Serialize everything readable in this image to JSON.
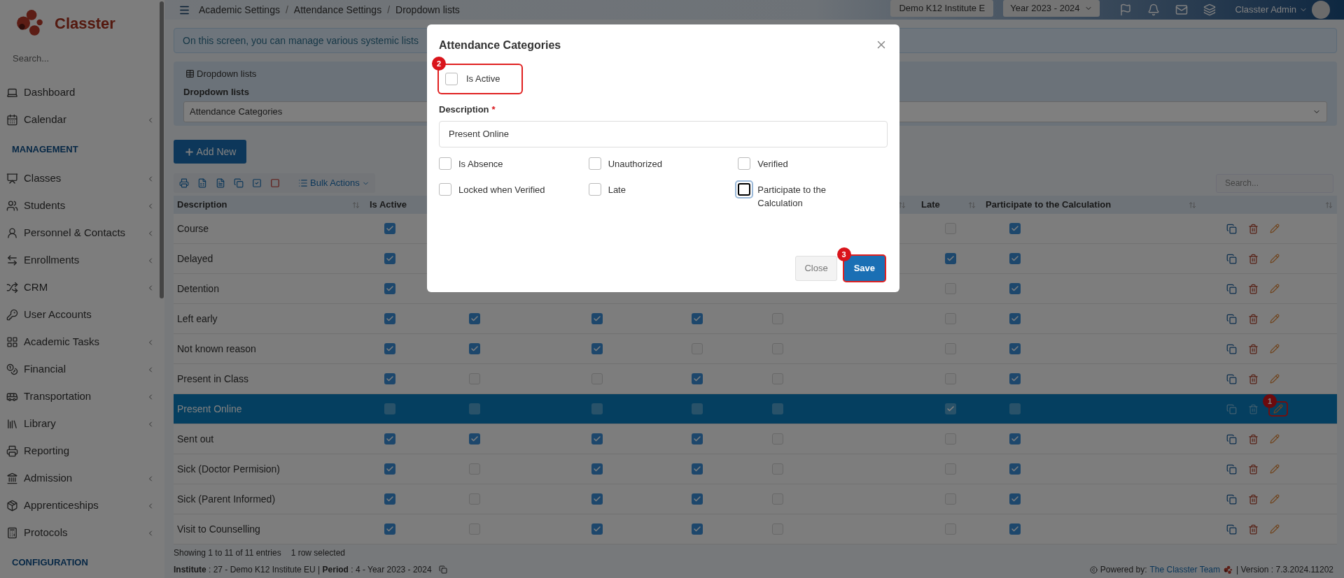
{
  "sidebar": {
    "logo_text": "Classter",
    "search_placeholder": "Search...",
    "items": [
      {
        "kind": "link",
        "label": "Dashboard",
        "has_submenu": false
      },
      {
        "kind": "link",
        "label": "Calendar",
        "has_submenu": true
      },
      {
        "kind": "section",
        "label": "MANAGEMENT"
      },
      {
        "kind": "link",
        "label": "Classes",
        "has_submenu": true
      },
      {
        "kind": "link",
        "label": "Students",
        "has_submenu": true
      },
      {
        "kind": "link",
        "label": "Personnel & Contacts",
        "has_submenu": true
      },
      {
        "kind": "link",
        "label": "Enrollments",
        "has_submenu": true
      },
      {
        "kind": "link",
        "label": "CRM",
        "has_submenu": true
      },
      {
        "kind": "link",
        "label": "User Accounts",
        "has_submenu": false
      },
      {
        "kind": "link",
        "label": "Academic Tasks",
        "has_submenu": true
      },
      {
        "kind": "link",
        "label": "Financial",
        "has_submenu": true
      },
      {
        "kind": "link",
        "label": "Transportation",
        "has_submenu": true
      },
      {
        "kind": "link",
        "label": "Library",
        "has_submenu": true
      },
      {
        "kind": "link",
        "label": "Reporting",
        "has_submenu": false
      },
      {
        "kind": "link",
        "label": "Admission",
        "has_submenu": true
      },
      {
        "kind": "link",
        "label": "Apprenticeships",
        "has_submenu": true
      },
      {
        "kind": "link",
        "label": "Protocols",
        "has_submenu": true
      },
      {
        "kind": "section",
        "label": "CONFIGURATION"
      }
    ]
  },
  "header": {
    "breadcrumb_separator": "/",
    "breadcrumbs": [
      "Academic Settings",
      "Attendance Settings",
      "Dropdown lists"
    ],
    "institute_button": "Demo K12 Institute E",
    "year_dropdown": "Year 2023 - 2024",
    "user_name": "Classter Admin"
  },
  "info_banner": "On this screen, you can manage various systemic lists",
  "panel": {
    "title": "Dropdown lists",
    "field_label": "Dropdown lists",
    "select_value": "Attendance Categories"
  },
  "add_button": "Add New",
  "bulk_actions": "Bulk Actions",
  "table_search_placeholder": "Search...",
  "table": {
    "columns": [
      {
        "label": "Description"
      },
      {
        "label": "Is Active"
      },
      {
        "label": "Late"
      },
      {
        "label": "Participate to the Calculation"
      }
    ],
    "rows": [
      {
        "description": "Course",
        "selected": false,
        "is_active": true,
        "late": false,
        "participate": true
      },
      {
        "description": "Delayed",
        "selected": false,
        "is_active": true,
        "late": true,
        "participate": true
      },
      {
        "description": "Detention",
        "selected": false,
        "is_active": true,
        "late": false,
        "participate": true
      },
      {
        "description": "Left early",
        "selected": false,
        "is_active": true,
        "column_3": true,
        "column_4": true,
        "column_5": true,
        "column_6": false,
        "late": false,
        "participate": true
      },
      {
        "description": "Not known reason",
        "selected": false,
        "is_active": true,
        "column_3": true,
        "column_4": true,
        "column_5": false,
        "column_6": false,
        "late": false,
        "participate": true
      },
      {
        "description": "Present in Class",
        "selected": false,
        "is_active": true,
        "column_3": false,
        "column_4": false,
        "column_5": true,
        "column_6": false,
        "late": false,
        "participate": true
      },
      {
        "description": "Present Online",
        "selected": true,
        "is_active": false,
        "column_3": false,
        "column_4": false,
        "column_5": false,
        "column_6": false,
        "late": true,
        "participate": false,
        "callout": "1"
      },
      {
        "description": "Sent out",
        "selected": false,
        "is_active": true,
        "column_3": true,
        "column_4": true,
        "column_5": true,
        "column_6": false,
        "late": false,
        "participate": true
      },
      {
        "description": "Sick (Doctor Permision)",
        "selected": false,
        "is_active": true,
        "column_3": false,
        "column_4": true,
        "column_5": true,
        "column_6": false,
        "late": false,
        "participate": true
      },
      {
        "description": "Sick (Parent Informed)",
        "selected": false,
        "is_active": true,
        "column_3": false,
        "column_4": true,
        "column_5": true,
        "column_6": false,
        "late": false,
        "participate": true
      },
      {
        "description": "Visit to Counselling",
        "selected": false,
        "is_active": true,
        "column_3": false,
        "column_4": true,
        "column_5": true,
        "column_6": false,
        "late": false,
        "participate": true
      }
    ]
  },
  "table_info": [
    "Showing 1 to 11 of 11 entries",
    "1 row selected"
  ],
  "footer": {
    "context": "**Institute** : 27 - Demo K12 Institute EU | **Period** : 4 - Year 2023 - 2024",
    "powered_label": "Powered by:",
    "powered_link": "The Classter Team",
    "version": "| Version : 7.3.2024.11202"
  },
  "modal": {
    "title": "Attendance Categories",
    "is_active": {
      "label": "Is Active",
      "checked": false,
      "callout": "2"
    },
    "description_label": "Description",
    "required_mark": "*",
    "description_value": "Present Online",
    "checkboxes": [
      {
        "label": "Is Absence",
        "checked": false,
        "focused": false
      },
      {
        "label": "Unauthorized",
        "checked": false,
        "focused": false
      },
      {
        "label": "Verified",
        "checked": false,
        "focused": false
      },
      {
        "label": "Locked when Verified",
        "checked": false,
        "focused": false
      },
      {
        "label": "Late",
        "checked": false,
        "focused": false
      },
      {
        "label": "Participate to the Calculation",
        "checked": false,
        "focused": true
      }
    ],
    "close_button": "Close",
    "save_button": {
      "label": "Save",
      "callout": "3"
    }
  }
}
